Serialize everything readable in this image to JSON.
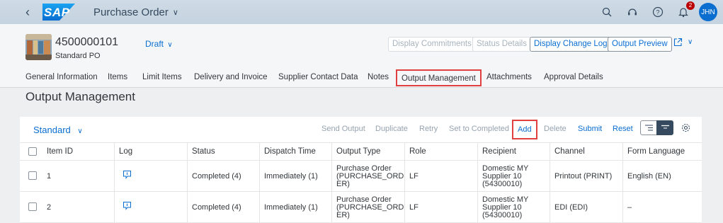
{
  "shell": {
    "logo_text": "SAP",
    "app_title": "Purchase Order",
    "notification_count": "2",
    "user_initials": "JHN",
    "icons": [
      "back-icon",
      "search-icon",
      "help-icon",
      "notification-icon"
    ]
  },
  "header": {
    "po_number": "4500000101",
    "po_type": "Standard PO",
    "status": "Draft",
    "buttons": {
      "display_commitments": "Display Commitments",
      "status_details": "Status Details",
      "display_change_log": "Display Change Log",
      "output_preview": "Output Preview"
    }
  },
  "tabs": [
    {
      "label": "General Information"
    },
    {
      "label": "Items"
    },
    {
      "label": "Limit Items"
    },
    {
      "label": "Delivery and Invoice"
    },
    {
      "label": "Supplier Contact Data"
    },
    {
      "label": "Notes"
    },
    {
      "label": "Output Management",
      "selected": true
    },
    {
      "label": "Attachments"
    },
    {
      "label": "Approval Details"
    }
  ],
  "section": {
    "title": "Output Management",
    "variant": "Standard",
    "toolbar": {
      "send_output": "Send Output",
      "duplicate": "Duplicate",
      "retry": "Retry",
      "set_to_completed": "Set to Completed",
      "add": "Add",
      "delete": "Delete",
      "submit": "Submit",
      "reset": "Reset"
    }
  },
  "table": {
    "columns": [
      "Item ID",
      "Log",
      "Status",
      "Dispatch Time",
      "Output Type",
      "Role",
      "Recipient",
      "Channel",
      "Form Language"
    ],
    "rows": [
      {
        "item_id": "1",
        "status": "Completed (4)",
        "dispatch_time": "Immediately (1)",
        "output_type": [
          "Purchase Order",
          "(PURCHASE_ORD",
          "ER)"
        ],
        "role": "LF",
        "recipient": [
          "Domestic MY",
          "Supplier 10",
          "(54300010)"
        ],
        "channel": "Printout (PRINT)",
        "form_language": "English (EN)"
      },
      {
        "item_id": "2",
        "status": "Completed (4)",
        "dispatch_time": "Immediately (1)",
        "output_type": [
          "Purchase Order",
          "(PURCHASE_ORD",
          "ER)"
        ],
        "role": "LF",
        "recipient": [
          "Domestic MY",
          "Supplier 10",
          "(54300010)"
        ],
        "channel": "EDI (EDI)",
        "form_language": "–"
      }
    ]
  },
  "colors": {
    "accent": "#0a6ed1",
    "highlight_box": "#e04040",
    "shell_bg": "#c4d3e0"
  }
}
